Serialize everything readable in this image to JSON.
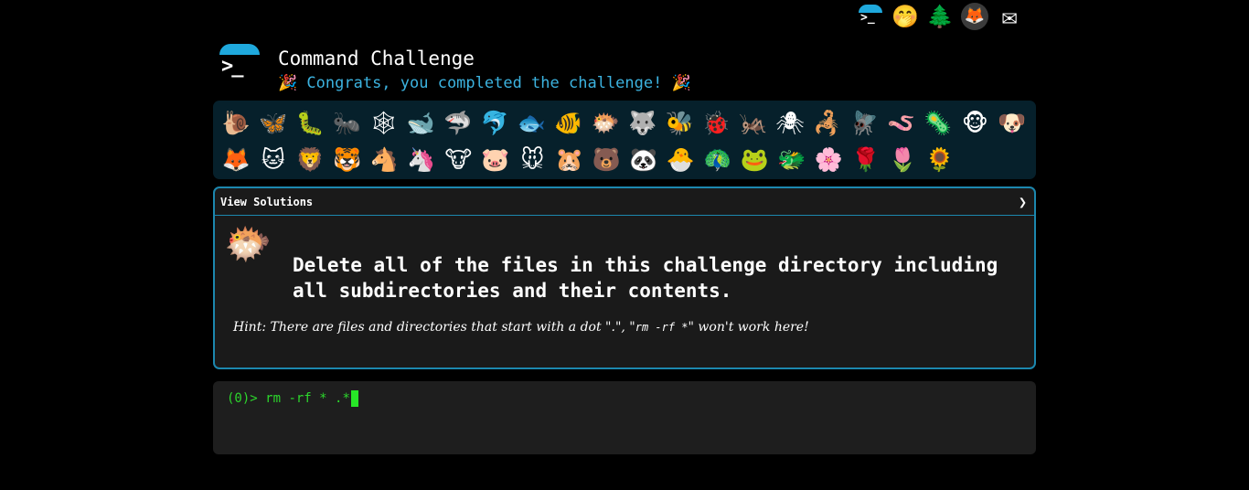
{
  "topnav": {
    "items": [
      {
        "name": "terminal-logo",
        "glyph": ">_"
      },
      {
        "name": "face-with-hand-over-mouth",
        "glyph": "🤭"
      },
      {
        "name": "evergreen-tree",
        "glyph": "🌲"
      },
      {
        "name": "gitlab",
        "glyph": "🦊"
      },
      {
        "name": "envelope",
        "glyph": "✉"
      }
    ]
  },
  "header": {
    "logo_glyph": ">_",
    "title": "Command Challenge",
    "congrats": "Congrats, you completed the challenge!",
    "party_left": "🎉",
    "party_right": "🎉"
  },
  "emoji_rows": [
    [
      "🐌",
      "🦋",
      "🐛",
      "🐜",
      "🕸",
      "🐋",
      "🦈",
      "🐬",
      "🐟",
      "🐠",
      "🐡",
      "🐺",
      "🐝",
      "🐞",
      "🦗",
      "🕷",
      "🦂",
      "🪰",
      "🪱",
      "🦠",
      "🐵",
      "🐶"
    ],
    [
      "🦊",
      "🐱",
      "🦁",
      "🐯",
      "🐴",
      "🦄",
      "🐮",
      "🐷",
      "🐭",
      "🐹",
      "🐻",
      "🐼",
      "🐣",
      "🦚",
      "🐸",
      "🐲",
      "🌸",
      "🌹",
      "🌷",
      "🌻"
    ]
  ],
  "challenge": {
    "solutions_label": "View Solutions",
    "chevron": "❯",
    "avatar": "🐡",
    "task": "Delete all of the files in this challenge directory including all subdirectories and their contents.",
    "hint_prefix": "Hint: There are files and directories that start with a dot \".\", \"",
    "hint_code": "rm -rf *",
    "hint_suffix": "\" won't work here!"
  },
  "terminal": {
    "prompt": "(0)>",
    "command": "rm -rf * .*"
  },
  "colors": {
    "accent": "#1fa9dd",
    "congrats": "#3cb3e0",
    "terminal_green": "#2cd72c",
    "panel_bg": "#06202b",
    "border": "#1c87ae"
  }
}
